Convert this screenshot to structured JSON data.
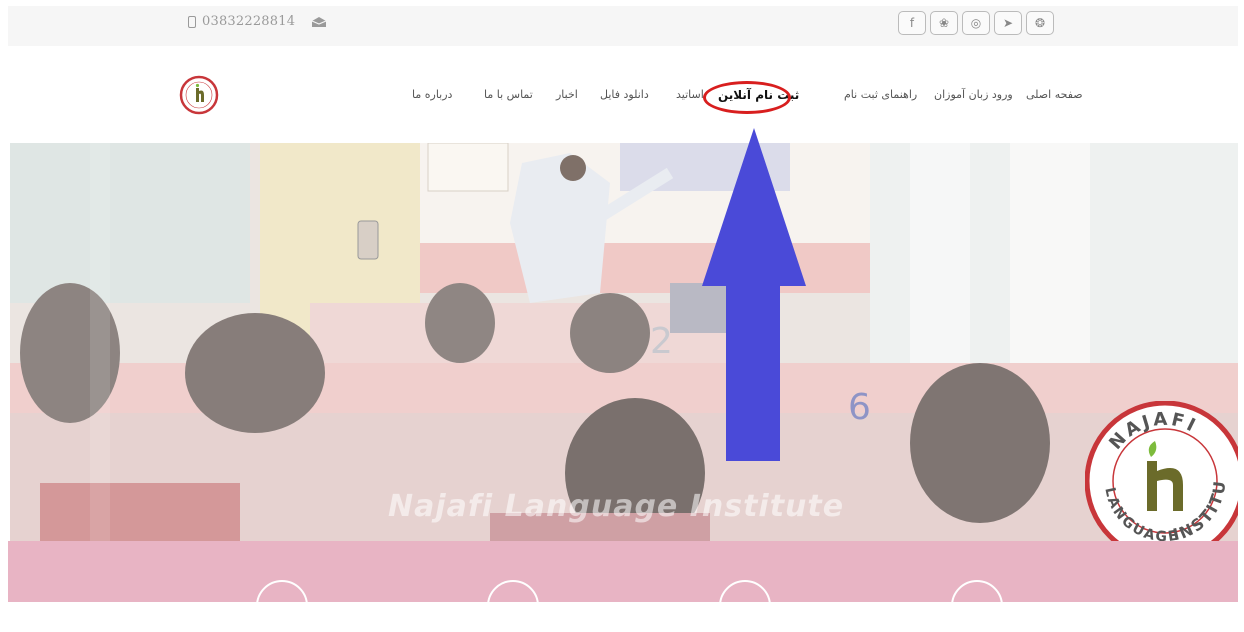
{
  "topbar": {
    "phone": "03832228814",
    "icons": [
      "phone-icon",
      "envelope-icon"
    ],
    "social": [
      {
        "name": "facebook-icon",
        "glyph": "f"
      },
      {
        "name": "twitter-icon",
        "glyph": "❀"
      },
      {
        "name": "instagram-icon",
        "glyph": "◎"
      },
      {
        "name": "telegram-icon",
        "glyph": "➤"
      },
      {
        "name": "dribbble-icon",
        "glyph": "❂"
      }
    ]
  },
  "nav": {
    "items": [
      {
        "label": "صفحه اصلی"
      },
      {
        "label": "ورود زبان آموزان"
      },
      {
        "label": "راهنمای ثبت نام"
      },
      {
        "label": "ثبت نام آنلاین",
        "active": true
      },
      {
        "label": "اساتید"
      },
      {
        "label": "دانلود فایل"
      },
      {
        "label": "اخبار"
      },
      {
        "label": "تماس با ما"
      },
      {
        "label": "درباره ما"
      }
    ]
  },
  "hero": {
    "watermark": "Najafi Language Institute",
    "logo_text_top": "NAJAFI",
    "logo_text_left": "LANGUAGE",
    "logo_text_right": "INSTITUTE"
  },
  "colors": {
    "annotation_oval": "#d81e1e",
    "annotation_arrow": "#4a4ad8",
    "pink_band": "#e8b4c4",
    "logo_green": "#7dbb3c",
    "logo_red": "#c8363a"
  }
}
